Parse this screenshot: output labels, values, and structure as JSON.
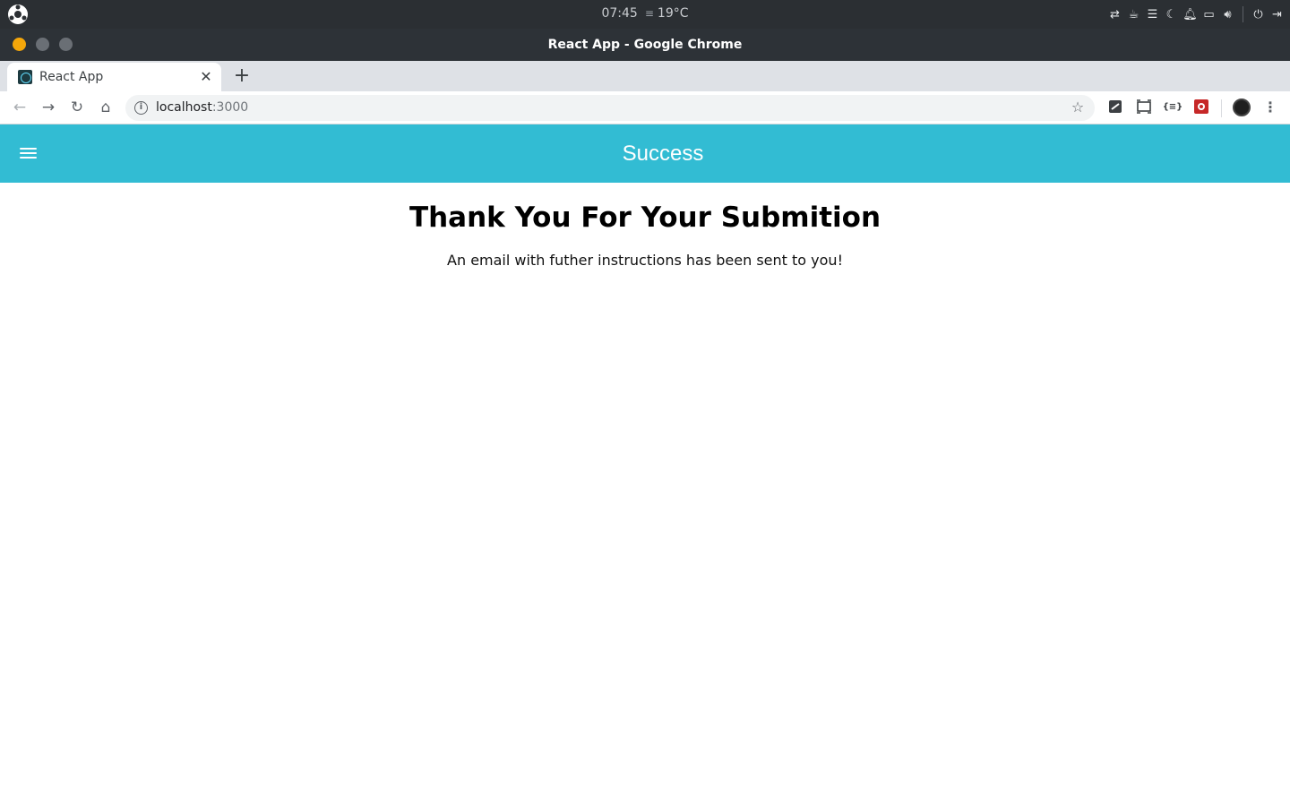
{
  "os": {
    "time": "07:45",
    "weather_icon": "fog-icon",
    "temperature": "19°C",
    "tray_icons": [
      "share-icon",
      "coffee-icon",
      "list-icon",
      "moon-icon",
      "bell-icon",
      "folder-icon",
      "volume-icon",
      "power-icon",
      "exit-icon"
    ]
  },
  "window": {
    "title": "React App - Google Chrome"
  },
  "tabs": [
    {
      "label": "React App",
      "active": true
    }
  ],
  "toolbar": {
    "url_host": "localhost",
    "url_port": ":3000",
    "extensions": [
      "pdf-extension-icon",
      "screenshot-extension-icon",
      "json-extension-icon",
      "red-extension-icon"
    ]
  },
  "app": {
    "header_title": "Success",
    "header_color": "#32bcd3",
    "heading": "Thank You For Your Submition",
    "message": "An email with futher instructions has been sent to you!"
  }
}
